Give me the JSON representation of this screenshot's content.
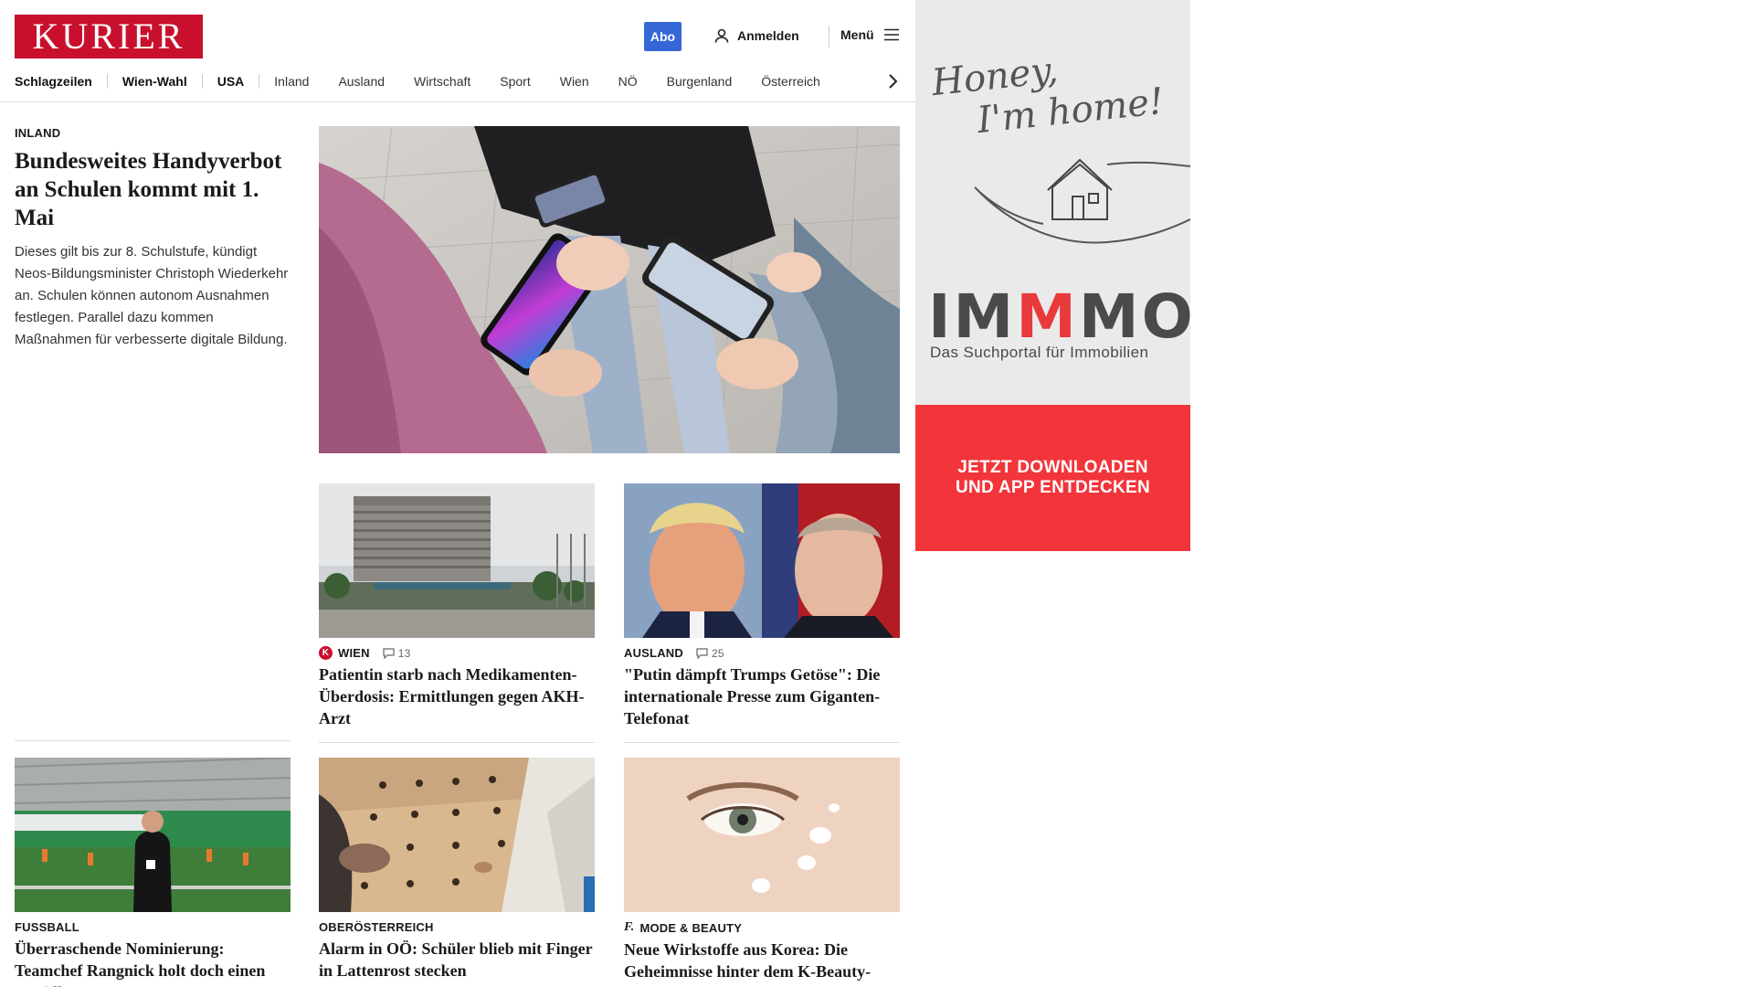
{
  "header": {
    "logo": "KURIER",
    "abo_label": "Abo",
    "login_label": "Anmelden",
    "menu_label": "Menü"
  },
  "nav": {
    "items": [
      "Schlagzeilen",
      "Wien-Wahl",
      "USA",
      "Inland",
      "Ausland",
      "Wirtschaft",
      "Sport",
      "Wien",
      "NÖ",
      "Burgenland",
      "Österreich"
    ]
  },
  "lead": {
    "kicker": "INLAND",
    "headline": "Bundesweites Handyverbot an Schulen kommt mit 1. Mai",
    "teaser": "Dieses gilt bis zur 8. Schulstufe, kündigt Neos-Bildungsminister Christoph Wiederkehr an. Schulen können autonom Ausnahmen festlegen. Parallel dazu kommen Maßnahmen für verbesserte digitale Bildung."
  },
  "cards": [
    {
      "kicker": "WIEN",
      "comments": "13",
      "badge": "K",
      "headline": "Patientin starb nach Medikamenten-Überdosis: Ermittlungen gegen AKH-Arzt"
    },
    {
      "kicker": "AUSLAND",
      "comments": "25",
      "headline": "\"Putin dämpft Trumps Getöse\": Die internationale Presse zum Giganten-Telefonat"
    },
    {
      "kicker": "FUSSBALL",
      "headline": "Überraschende Nominierung: Teamchef Rangnick holt doch einen Rapidler"
    },
    {
      "kicker": "OBERÖSTERREICH",
      "headline": "Alarm in OÖ: Schüler blieb mit Finger in Lattenrost stecken"
    },
    {
      "kicker": "MODE & BEAUTY",
      "badge": "f.",
      "headline": "Neue Wirkstoffe aus Korea: Die Geheimnisse hinter dem K-Beauty-Boom"
    }
  ],
  "ad": {
    "script_line1": "Honey,",
    "script_line2": "I'm home!",
    "brand_a": "IM",
    "brand_b": "M",
    "brand_c": "MO",
    "tagline": "Das Suchportal für Immobilien",
    "cta_line1": "JETZT DOWNLOADEN",
    "cta_line2": "UND APP ENTDECKEN"
  },
  "colors": {
    "brand_red": "#c8102e",
    "abo_blue": "#3567d6",
    "ad_red": "#f2353a"
  }
}
